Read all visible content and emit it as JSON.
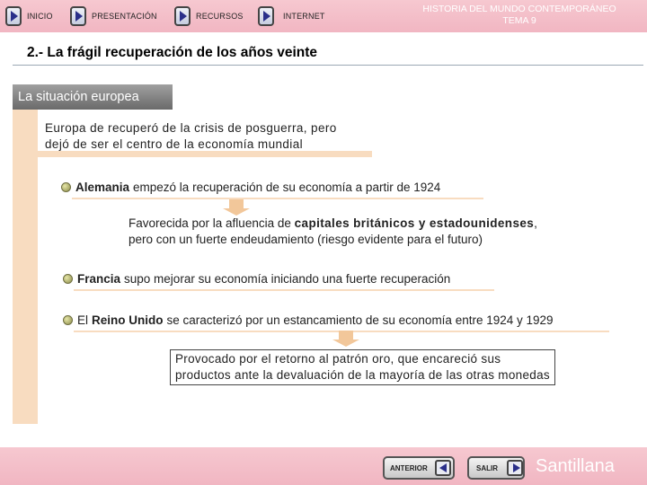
{
  "nav": {
    "inicio": "INICIO",
    "presentacion": "PRESENTACIÓN",
    "recursos": "RECURSOS",
    "internet": "INTERNET"
  },
  "header": {
    "title_line1": "HISTORIA DEL MUNDO CONTEMPORÁNEO",
    "title_line2": "TEMA 9"
  },
  "section_title": "2.- La frágil recuperación de los años veinte",
  "subhead": "La situación europea",
  "intro": {
    "line1": "Europa de recuperó de la crisis de posguerra, pero",
    "line2": "dejó de ser el centro de la economía mundial"
  },
  "alemania": {
    "bold": "Alemania",
    "rest": "empezó la recuperación de su economía a partir de 1924",
    "detail_pre": "Favorecida por la afluencia de ",
    "detail_bold": "capitales británicos y estadounidenses",
    "detail_post": ",",
    "detail_line2": "pero con un fuerte endeudamiento (riesgo evidente para el futuro)"
  },
  "francia": {
    "bold": "Francia",
    "rest": "supo mejorar su economía iniciando una fuerte recuperación"
  },
  "reino_unido": {
    "pre": "El",
    "bold": "Reino Unido",
    "rest": "se caracterizó por un estancamiento de su economía entre 1924 y 1929",
    "detail_line1": "Provocado por el retorno al patrón oro, que encareció sus",
    "detail_line2": "productos ante la devaluación de la mayoría de las otras monedas"
  },
  "footer": {
    "anterior": "ANTERIOR",
    "salir": "SALIR",
    "brand": "Santillana"
  },
  "colors": {
    "bar": "#f1b6c2",
    "band": "#f8dcc0",
    "accent": "#2a2f8a"
  }
}
